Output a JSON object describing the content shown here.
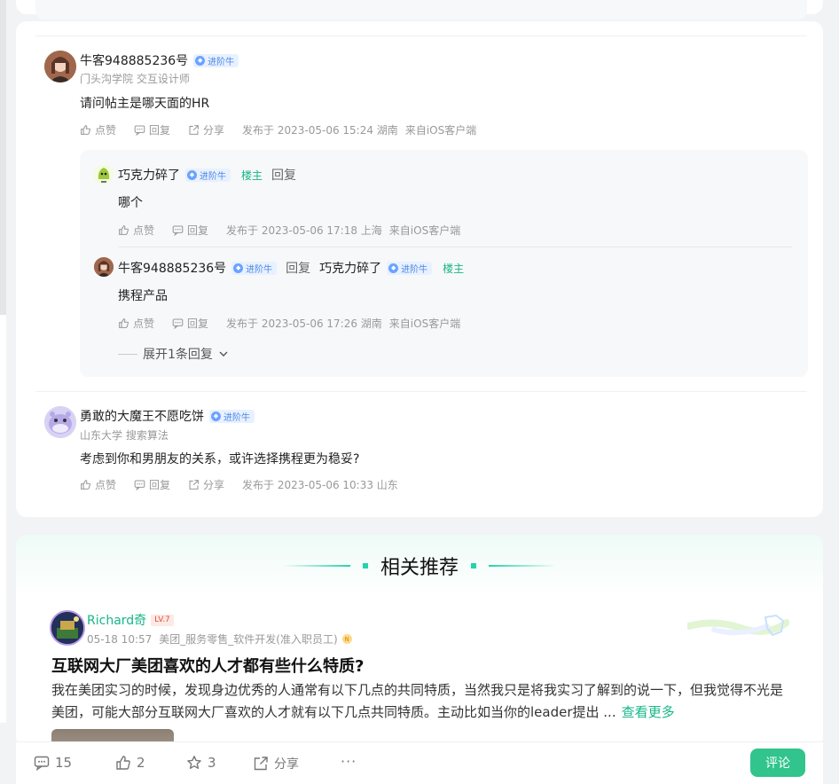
{
  "comments": [
    {
      "name": "牛客948885236号",
      "badge": "进阶牛",
      "subtitle": "门头沟学院 交互设计师",
      "content": "请问帖主是哪天面的HR",
      "like": "点赞",
      "reply": "回复",
      "share": "分享",
      "time": "发布于 2023-05-06 15:24 湖南",
      "client": "来自iOS客户端",
      "replies": [
        {
          "name": "巧克力碎了",
          "badge": "进阶牛",
          "tag": "楼主",
          "reply_label": "回复",
          "content": "哪个",
          "like": "点赞",
          "reply": "回复",
          "time": "发布于 2023-05-06 17:18 上海",
          "client": "来自iOS客户端"
        },
        {
          "name": "牛客948885236号",
          "badge": "进阶牛",
          "reply_word": "回复",
          "target": "巧克力碎了",
          "target_badge": "进阶牛",
          "target_tag": "楼主",
          "content": "携程产品",
          "like": "点赞",
          "reply": "回复",
          "time": "发布于 2023-05-06 17:26 湖南",
          "client": "来自iOS客户端"
        }
      ],
      "expand_label": "展开1条回复"
    },
    {
      "name": "勇敢的大魔王不愿吃饼",
      "badge": "进阶牛",
      "subtitle": "山东大学 搜索算法",
      "content": "考虑到你和男朋友的关系，或许选择携程更为稳妥?",
      "like": "点赞",
      "reply": "回复",
      "share": "分享",
      "time": "发布于 2023-05-06 10:33 山东"
    }
  ],
  "recommend": {
    "title": "相关推荐",
    "author": "Richard奇",
    "level": "LV.7",
    "date": "05-18 10:57",
    "company": "美团_服务零售_软件开发(准入职员工)",
    "company_badge": "N",
    "post_title": "互联网大厂美团喜欢的人才都有些什么特质?",
    "post_body": "我在美团实习的时候，发现身边优秀的人通常有以下几点的共同特质，当然我只是将我实习了解到的说一下，但我觉得不光是美团，可能大部分互联网大厂喜欢的人才就有以下几点共同特质。主动比如当你的leader提出 ...",
    "more": "查看更多"
  },
  "bottom": {
    "comments": "15",
    "likes": "2",
    "stars": "3",
    "share": "分享",
    "more": "···",
    "comment_button": "评论"
  },
  "colors": {
    "accent": "#31c48d",
    "louzhu": "#16b687",
    "badge_bg": "#e8f1ff"
  }
}
